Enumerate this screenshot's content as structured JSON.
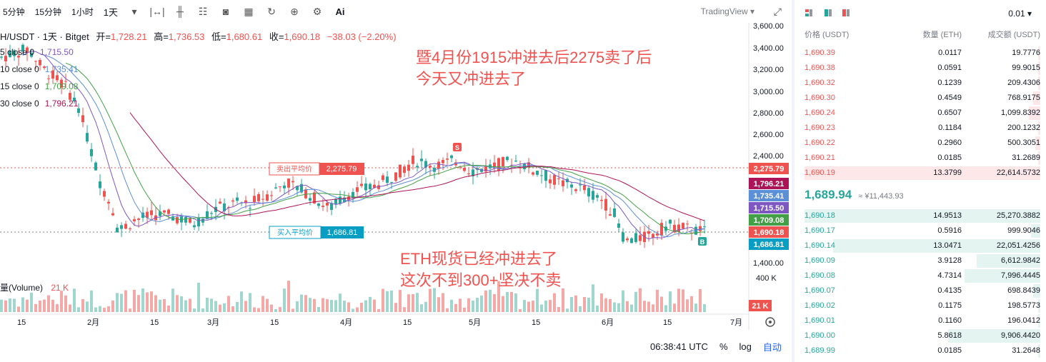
{
  "toolbar": {
    "timeframes": [
      "5分钟",
      "15分钟",
      "1小时",
      "1天"
    ],
    "active_timeframe": "1天",
    "ai_label": "Ai",
    "brand": "TradingView"
  },
  "legend": {
    "symbol": "H/USDT · 1天 · Bitget",
    "open_label": "开=",
    "open": "1,728.21",
    "high_label": "高=",
    "high": "1,736.53",
    "low_label": "低=",
    "low": "1,680.61",
    "close_label": "收=",
    "close": "1,690.18",
    "change": "−38.03 (−2.20%)"
  },
  "moving_averages": [
    {
      "label": "5 close 0",
      "value": "1,715.50",
      "color": "#7e57c2"
    },
    {
      "label": "10 close 0",
      "value": "1,735.41",
      "color": "#5b8fd6"
    },
    {
      "label": "15 close 0",
      "value": "1,709.08",
      "color": "#43a047"
    },
    {
      "label": "30 close 0",
      "value": "1,796.21",
      "color": "#ad1457"
    }
  ],
  "volume_label": "量(Volume)",
  "volume_value": "21 K",
  "annotations": {
    "sell_avg_label": "卖出平均价",
    "sell_avg_value": "2,275.79",
    "buy_avg_label": "买入平均价",
    "buy_avg_value": "1,686.81",
    "marker_s": "S",
    "marker_b": "B",
    "note1": [
      "暨4月份1915冲进去后2275卖了后",
      "今天又冲进去了"
    ],
    "note2": [
      "ETH现货已经冲进去了",
      "这次不到300+坚决不卖"
    ]
  },
  "price_axis": [
    "3,600.00",
    "3,400.00",
    "3,200.00",
    "3,000.00",
    "2,800.00",
    "2,600.00",
    "2,400.00",
    "1,400.00"
  ],
  "price_tags": [
    {
      "value": "2,275.79",
      "color": "#ef5350"
    },
    {
      "value": "1,796.21",
      "color": "#ad1457"
    },
    {
      "value": "1,735.41",
      "color": "#5b8fd6"
    },
    {
      "value": "1,715.50",
      "color": "#7e57c2"
    },
    {
      "value": "1,709.08",
      "color": "#43a047"
    },
    {
      "value": "1,690.18",
      "color": "#ef5350"
    },
    {
      "value": "1,686.81",
      "color": "#089ec4"
    }
  ],
  "volume_axis": "400 K",
  "volume_tag": "21 K",
  "time_axis": [
    "15",
    "2月",
    "15",
    "3月",
    "15",
    "4月",
    "15",
    "5月",
    "15",
    "6月",
    "15",
    "7月"
  ],
  "bottom": {
    "time": "06:38:41 UTC",
    "percent": "%",
    "log": "log",
    "auto": "自动"
  },
  "orderbook": {
    "precision": "0.01",
    "headers": {
      "price": "价格 (USDT)",
      "qty": "数量 (ETH)",
      "total": "成交额 (USDT)"
    },
    "asks": [
      {
        "price": "1,690.39",
        "qty": "0.0117",
        "total": "19.7776",
        "depth": 0.01
      },
      {
        "price": "1,690.38",
        "qty": "0.0591",
        "total": "99.9015",
        "depth": 0.01
      },
      {
        "price": "1,690.32",
        "qty": "0.1239",
        "total": "209.4306",
        "depth": 0.01
      },
      {
        "price": "1,690.30",
        "qty": "0.4549",
        "total": "768.9175",
        "depth": 0.03
      },
      {
        "price": "1,690.24",
        "qty": "0.6507",
        "total": "1,099.8392",
        "depth": 0.05
      },
      {
        "price": "1,690.23",
        "qty": "0.1184",
        "total": "200.1232",
        "depth": 0.01
      },
      {
        "price": "1,690.22",
        "qty": "0.2960",
        "total": "500.3051",
        "depth": 0.02
      },
      {
        "price": "1,690.21",
        "qty": "0.0185",
        "total": "31.2689",
        "depth": 0.01
      },
      {
        "price": "1,690.19",
        "qty": "13.3799",
        "total": "22,614.5732",
        "depth": 1.0
      }
    ],
    "last_price": "1,689.94",
    "last_price_cny": "≈ ¥11,443.93",
    "bids": [
      {
        "price": "1,690.18",
        "qty": "14.9513",
        "total": "25,270.3882",
        "depth": 1.0
      },
      {
        "price": "1,690.17",
        "qty": "0.5916",
        "total": "999.9046",
        "depth": 0.04
      },
      {
        "price": "1,690.14",
        "qty": "13.0471",
        "total": "22,051.4256",
        "depth": 0.88
      },
      {
        "price": "1,690.09",
        "qty": "3.9128",
        "total": "6,612.9842",
        "depth": 0.27
      },
      {
        "price": "1,690.08",
        "qty": "4.7314",
        "total": "7,996.4445",
        "depth": 0.32
      },
      {
        "price": "1,690.07",
        "qty": "0.4135",
        "total": "698.8439",
        "depth": 0.03
      },
      {
        "price": "1,690.02",
        "qty": "0.1175",
        "total": "198.5773",
        "depth": 0.01
      },
      {
        "price": "1,690.01",
        "qty": "0.1160",
        "total": "196.0412",
        "depth": 0.01
      },
      {
        "price": "1,690.00",
        "qty": "5.8618",
        "total": "9,906.4420",
        "depth": 0.39
      },
      {
        "price": "1,689.99",
        "qty": "0.0185",
        "total": "31.2648",
        "depth": 0.01
      }
    ]
  }
}
